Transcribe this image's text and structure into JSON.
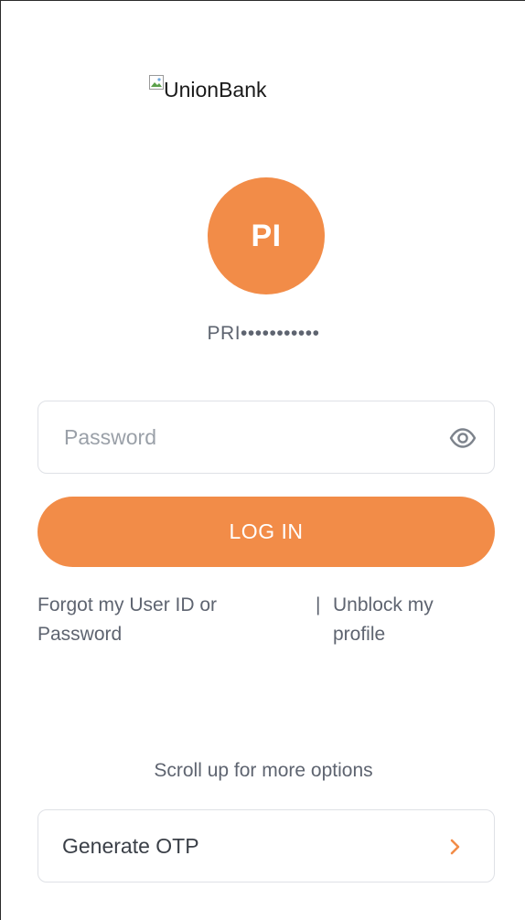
{
  "logo": {
    "alt_text": "UnionBank"
  },
  "profile": {
    "initials": "PI",
    "masked_user_id": "PRI•••••••••••"
  },
  "password": {
    "placeholder": "Password",
    "value": "",
    "toggle_icon": "eye-icon"
  },
  "login_button": {
    "label": "LOG IN"
  },
  "links": {
    "forgot": "Forgot my User ID or Password",
    "separator": "|",
    "unblock": "Unblock my profile"
  },
  "scroll_hint": "Scroll up for more options",
  "otp": {
    "label": "Generate OTP",
    "icon": "chevron-right-icon"
  },
  "colors": {
    "accent": "#f28c48",
    "text_muted": "#5e6470",
    "border": "#dfe1e6"
  }
}
